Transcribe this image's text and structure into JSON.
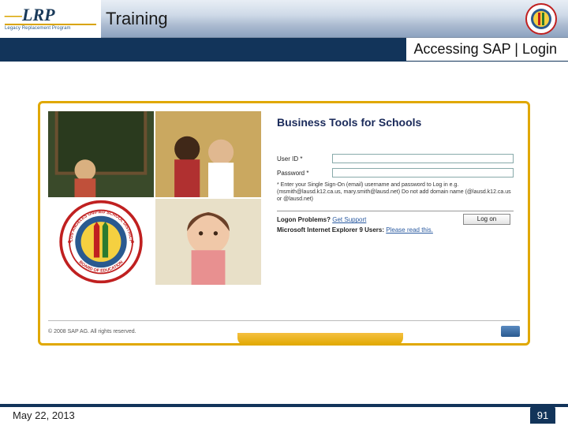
{
  "header": {
    "logo_main": "LRP",
    "logo_sub": "Legacy Replacement Program",
    "title": "Training"
  },
  "subtitle": "Accessing SAP | Login",
  "portal": {
    "title": "Business Tools for Schools",
    "user_label": "User ID *",
    "password_label": "Password *",
    "hint": "* Enter your Single Sign-On (email) username and password to Log in e.g. (msmith@lausd.k12.ca.us, mary.smith@lausd.net) Do not add domain name (@lausd.k12.ca.us or @lausd.net)",
    "logon_label": "Log on",
    "problems_label": "Logon Problems?",
    "problems_link": "Get Support",
    "ie9_label": "Microsoft Internet Explorer 9 Users:",
    "ie9_link": "Please read this.",
    "copyright": "© 2008 SAP AG. All rights reserved."
  },
  "seal": {
    "outer_text_top": "LOS ANGELES UNIFIED",
    "outer_text_side": "SCHOOL DISTRICT",
    "outer_text_bottom": "BOARD OF EDUCATION"
  },
  "footer": {
    "date": "May 22, 2013",
    "page": "91"
  }
}
